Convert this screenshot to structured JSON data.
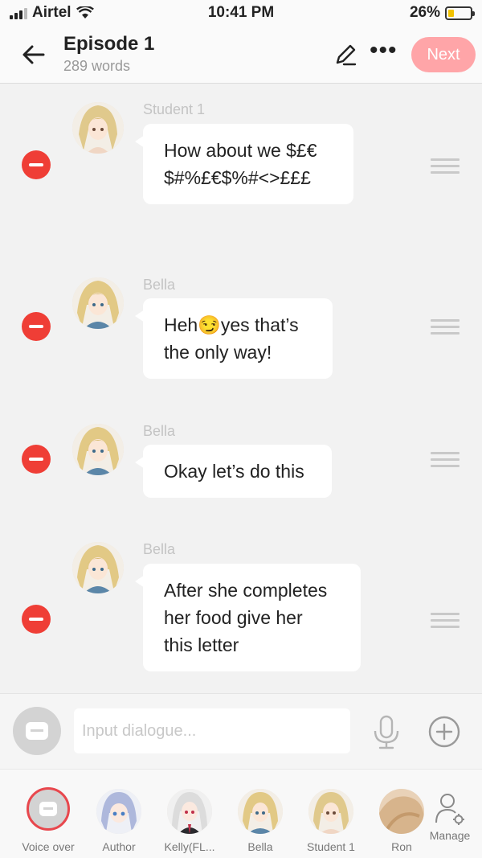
{
  "status": {
    "carrier": "Airtel",
    "time": "10:41 PM",
    "battery": "26%",
    "battery_level": 0.26
  },
  "header": {
    "title": "Episode 1",
    "subtitle": "289 words",
    "next_label": "Next"
  },
  "messages": [
    {
      "speaker": "Student 1",
      "lines": [
        "How about we $£€",
        "$#%£€$%#<>£££"
      ]
    },
    {
      "speaker": "Bella",
      "lines": [
        "Heh😏yes that’s",
        "the only way!"
      ]
    },
    {
      "speaker": "Bella",
      "lines": [
        "Okay let’s do this"
      ]
    },
    {
      "speaker": "Bella",
      "lines": [
        "After she completes",
        "her food give her",
        "this letter"
      ]
    }
  ],
  "input": {
    "placeholder": "Input dialogue..."
  },
  "characters": {
    "voice_over": "Voice over",
    "items": [
      "Author",
      "Kelly(FL...",
      "Bella",
      "Student 1",
      "Ron"
    ],
    "manage": "Manage"
  },
  "colors": {
    "accent": "#ef3e36",
    "next_button": "#ffa5a8"
  }
}
